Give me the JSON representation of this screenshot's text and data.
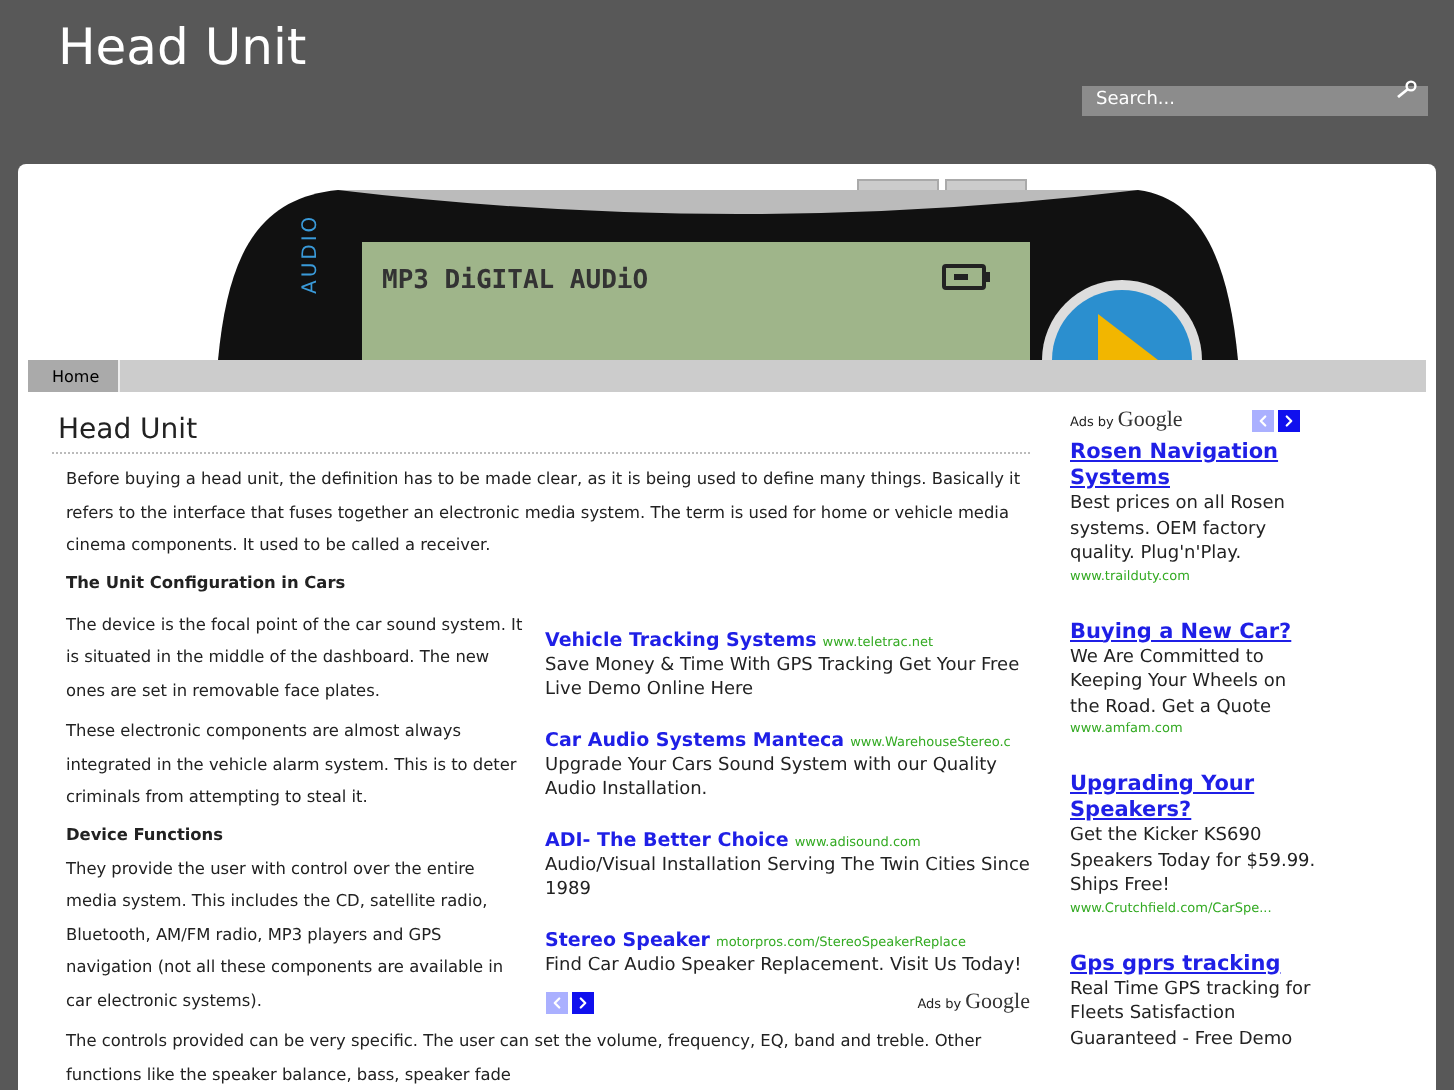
{
  "site": {
    "title": "Head Unit"
  },
  "search": {
    "placeholder": "Search..."
  },
  "banner": {
    "side_label": "AUDIO",
    "lcd_text": "MP3 DiGITAL AUDiO"
  },
  "nav": [
    {
      "label": "Home",
      "selected": true
    }
  ],
  "article": {
    "title": "Head Unit",
    "blocks": [
      {
        "kind": "para",
        "text": "Before buying a head unit, the definition has to be made clear, as it is being used to define many things. Basically it refers to the interface that fuses together an electronic media system. The term is used for home or vehicle media cinema components. It used to be called a receiver."
      },
      {
        "kind": "heading",
        "text": "The Unit Configuration in Cars"
      },
      {
        "kind": "with_ads",
        "blocks": [
          {
            "kind": "para",
            "text": "The device is the focal point of the car sound system. It is situated in the middle of the dashboard. The new ones are set in removable face plates."
          },
          {
            "kind": "para",
            "text": "These electronic components are almost always integrated in the vehicle alarm system. This is to deter criminals from attempting to steal it."
          },
          {
            "kind": "heading",
            "text": "Device Functions"
          },
          {
            "kind": "para",
            "text": "They provide the user with control over the entire media system. This includes the CD, satellite radio, Bluetooth, AM/FM radio, MP3 players and GPS navigation (not all these components are available in car electronic systems)."
          }
        ]
      },
      {
        "kind": "para",
        "text": "The controls provided can be very specific. The user can set the volume, frequency, EQ, band and treble. Other functions like the speaker balance, bass, speaker fade"
      }
    ]
  },
  "inline_ads": {
    "items": [
      {
        "title": "Vehicle Tracking Systems",
        "url": "www.teletrac.net",
        "text": "Save Money & Time With GPS Tracking Get Your Free Live Demo Online Here"
      },
      {
        "title": "Car Audio Systems Manteca",
        "url": "www.WarehouseStereo.c",
        "text": "Upgrade Your Cars Sound System with our Quality Audio Installation."
      },
      {
        "title": "ADI- The Better Choice",
        "url": "www.adisound.com",
        "text": "Audio/Visual Installation Serving The Twin Cities Since 1989"
      },
      {
        "title": "Stereo Speaker",
        "url": "motorpros.com/StereoSpeakerReplace",
        "text": "Find Car Audio Speaker Replacement. Visit Us Today!"
      }
    ],
    "pager": [
      {
        "kind": "prev",
        "disabled": true
      },
      {
        "kind": "next",
        "disabled": false
      }
    ],
    "ads_by": "Ads by",
    "brand": "Google"
  },
  "sidebar_ads": {
    "ads_by": "Ads by",
    "brand": "Google",
    "pager": [
      {
        "kind": "prev",
        "disabled": true
      },
      {
        "kind": "next",
        "disabled": false
      }
    ],
    "items": [
      {
        "title": "Rosen Navigation Systems",
        "text": "Best prices on all Rosen systems. OEM factory quality. Plug'n'Play.",
        "url": "www.trailduty.com"
      },
      {
        "title": "Buying a New Car?",
        "text": "We Are Committed to Keeping Your Wheels on the Road. Get a Quote",
        "url": "www.amfam.com"
      },
      {
        "title": "Upgrading Your Speakers?",
        "text": "Get the Kicker KS690 Speakers Today for $59.99. Ships Free!",
        "url": "www.Crutchfield.com/CarSpe..."
      },
      {
        "title": "Gps gprs tracking",
        "text": "Real Time GPS tracking for Fleets Satisfaction Guaranteed - Free Demo"
      }
    ]
  }
}
